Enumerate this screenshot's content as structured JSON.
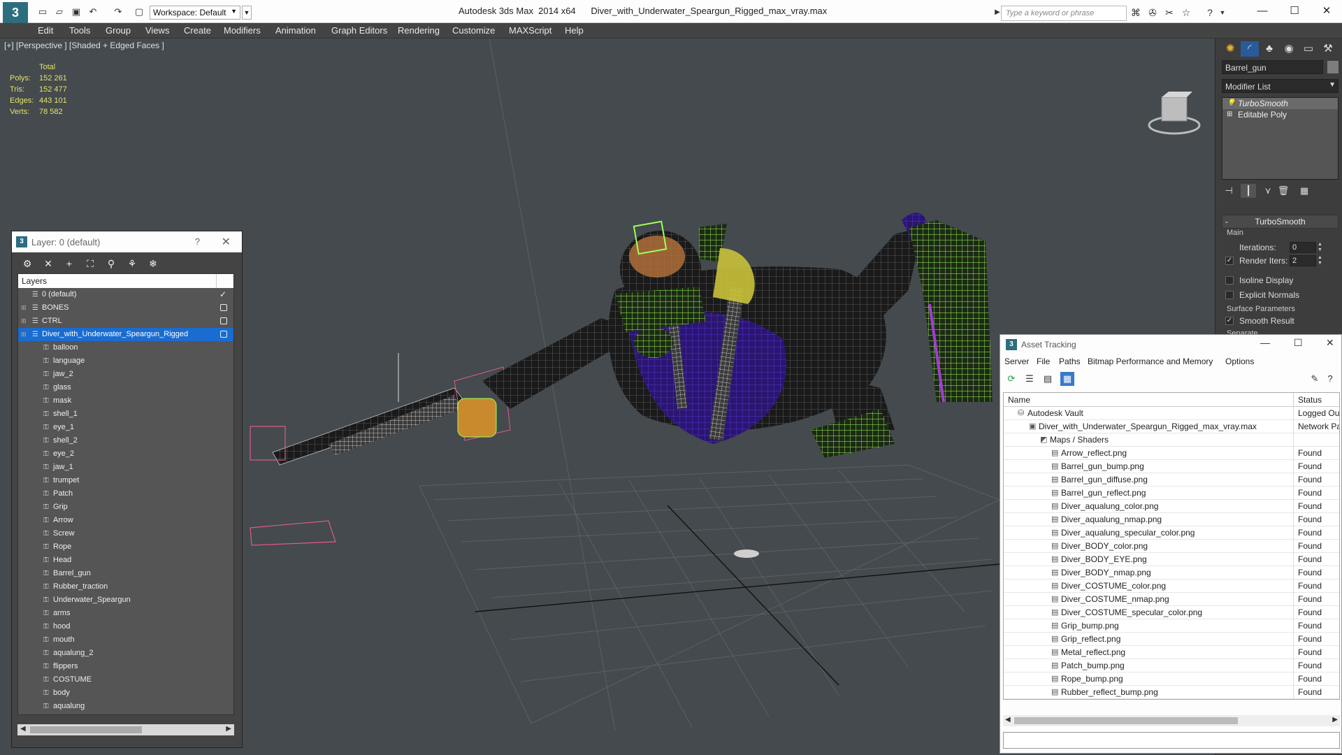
{
  "titlebar": {
    "workspace": "Workspace: Default",
    "title": "Autodesk 3ds Max  2014 x64      Diver_with_Underwater_Speargun_Rigged_max_vray.max",
    "search_placeholder": "Type a keyword or phrase"
  },
  "menu": [
    "Edit",
    "Tools",
    "Group",
    "Views",
    "Create",
    "Modifiers",
    "Animation",
    "Graph Editors",
    "Rendering",
    "Customize",
    "MAXScript",
    "Help"
  ],
  "viewport": {
    "label": "[+] [Perspective ] [Shaded + Edged Faces ]",
    "stats": {
      "header": "Total",
      "polys_label": "Polys:",
      "polys": "152 261",
      "tris_label": "Tris:",
      "tris": "152 477",
      "edges_label": "Edges:",
      "edges": "443 101",
      "verts_label": "Verts:",
      "verts": "78 582"
    }
  },
  "command_panel": {
    "object_name": "Barrel_gun",
    "modifier_list": "Modifier List",
    "stack": [
      "TurboSmooth",
      "Editable Poly"
    ],
    "rollout_title": "TurboSmooth",
    "group_main": "Main",
    "iterations_label": "Iterations:",
    "iterations_value": "0",
    "render_iters_label": "Render Iters:",
    "render_iters_value": "2",
    "isoline_label": "Isoline Display",
    "explicit_normals_label": "Explicit Normals",
    "group_surface": "Surface Parameters",
    "smooth_result_label": "Smooth Result",
    "separate_label": "Separate"
  },
  "layer_explorer": {
    "title": "Layer: 0 (default)",
    "column_header": "Layers",
    "layers": [
      {
        "name": "0 (default)",
        "checked": true
      },
      {
        "name": "BONES"
      },
      {
        "name": "CTRL"
      },
      {
        "name": "Diver_with_Underwater_Speargun_Rigged",
        "selected": true
      }
    ],
    "objects": [
      "balloon",
      "language",
      "jaw_2",
      "glass",
      "mask",
      "shell_1",
      "eye_1",
      "shell_2",
      "eye_2",
      "jaw_1",
      "trumpet",
      "Patch",
      "Grip",
      "Arrow",
      "Screw",
      "Rope",
      "Head",
      "Barrel_gun",
      "Rubber_traction",
      "Underwater_Speargun",
      "arms",
      "hood",
      "mouth",
      "aqualung_2",
      "flippers",
      "COSTUME",
      "body",
      "aqualung"
    ]
  },
  "asset_tracking": {
    "title": "Asset Tracking",
    "menu": [
      "Server",
      "File",
      "Paths",
      "Bitmap Performance and Memory",
      "Options"
    ],
    "col_name": "Name",
    "col_status": "Status",
    "vault": {
      "name": "Autodesk Vault",
      "status": "Logged Out"
    },
    "scene": {
      "name": "Diver_with_Underwater_Speargun_Rigged_max_vray.max",
      "status": "Network Path"
    },
    "group": {
      "name": "Maps / Shaders"
    },
    "maps": [
      {
        "name": "Arrow_reflect.png",
        "status": "Found"
      },
      {
        "name": "Barrel_gun_bump.png",
        "status": "Found"
      },
      {
        "name": "Barrel_gun_diffuse.png",
        "status": "Found"
      },
      {
        "name": "Barrel_gun_reflect.png",
        "status": "Found"
      },
      {
        "name": "Diver_aqualung_color.png",
        "status": "Found"
      },
      {
        "name": "Diver_aqualung_nmap.png",
        "status": "Found"
      },
      {
        "name": "Diver_aqualung_specular_color.png",
        "status": "Found"
      },
      {
        "name": "Diver_BODY_color.png",
        "status": "Found"
      },
      {
        "name": "Diver_BODY_EYE.png",
        "status": "Found"
      },
      {
        "name": "Diver_BODY_nmap.png",
        "status": "Found"
      },
      {
        "name": "Diver_COSTUME_color.png",
        "status": "Found"
      },
      {
        "name": "Diver_COSTUME_nmap.png",
        "status": "Found"
      },
      {
        "name": "Diver_COSTUME_specular_color.png",
        "status": "Found"
      },
      {
        "name": "Grip_bump.png",
        "status": "Found"
      },
      {
        "name": "Grip_reflect.png",
        "status": "Found"
      },
      {
        "name": "Metal_reflect.png",
        "status": "Found"
      },
      {
        "name": "Patch_bump.png",
        "status": "Found"
      },
      {
        "name": "Rope_bump.png",
        "status": "Found"
      },
      {
        "name": "Rubber_reflect_bump.png",
        "status": "Found"
      }
    ]
  },
  "colors": {
    "accent": "#1a6cd0",
    "stats_yellow": "#e6e26a",
    "wire_green": "#9cff5a",
    "wire_purple": "#5a2bd6"
  }
}
